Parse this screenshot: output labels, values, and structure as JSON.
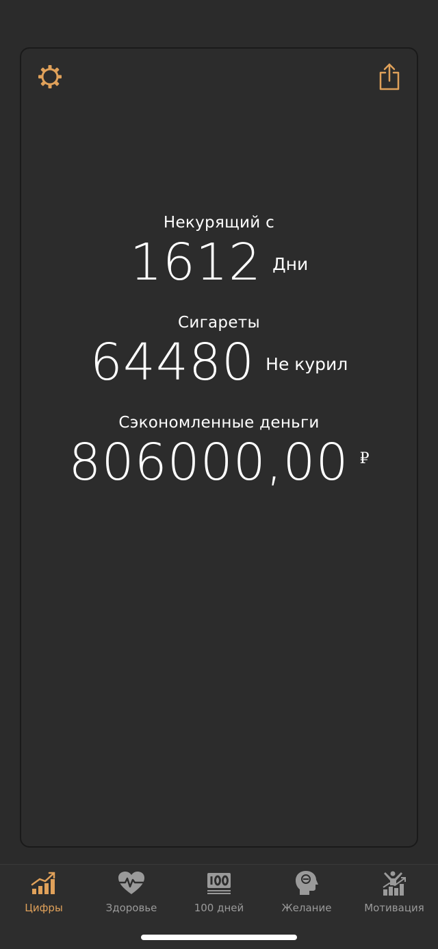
{
  "header": {
    "settings_icon": "gear-icon",
    "share_icon": "share-icon"
  },
  "stats": {
    "days": {
      "label": "Некурящий с",
      "value": "1612",
      "unit": "Дни"
    },
    "cigarettes": {
      "label": "Сигареты",
      "value": "64480",
      "unit": "Не курил"
    },
    "money": {
      "label": "Сэкономленные деньги",
      "value": "806000,00",
      "unit": "₽"
    }
  },
  "tabbar": {
    "tabs": [
      {
        "label": "Цифры",
        "icon": "chart-growth-icon",
        "active": true
      },
      {
        "label": "Здоровье",
        "icon": "heart-pulse-icon",
        "active": false
      },
      {
        "label": "100 дней",
        "icon": "hundred-days-icon",
        "active": false
      },
      {
        "label": "Желание",
        "icon": "head-profile-icon",
        "active": false
      },
      {
        "label": "Мотивация",
        "icon": "motivation-icon",
        "active": false
      }
    ]
  },
  "colors": {
    "accent": "#e0a15a",
    "background": "#2b2b2b",
    "inactive": "#9a9a9a",
    "text": "#ffffff"
  }
}
